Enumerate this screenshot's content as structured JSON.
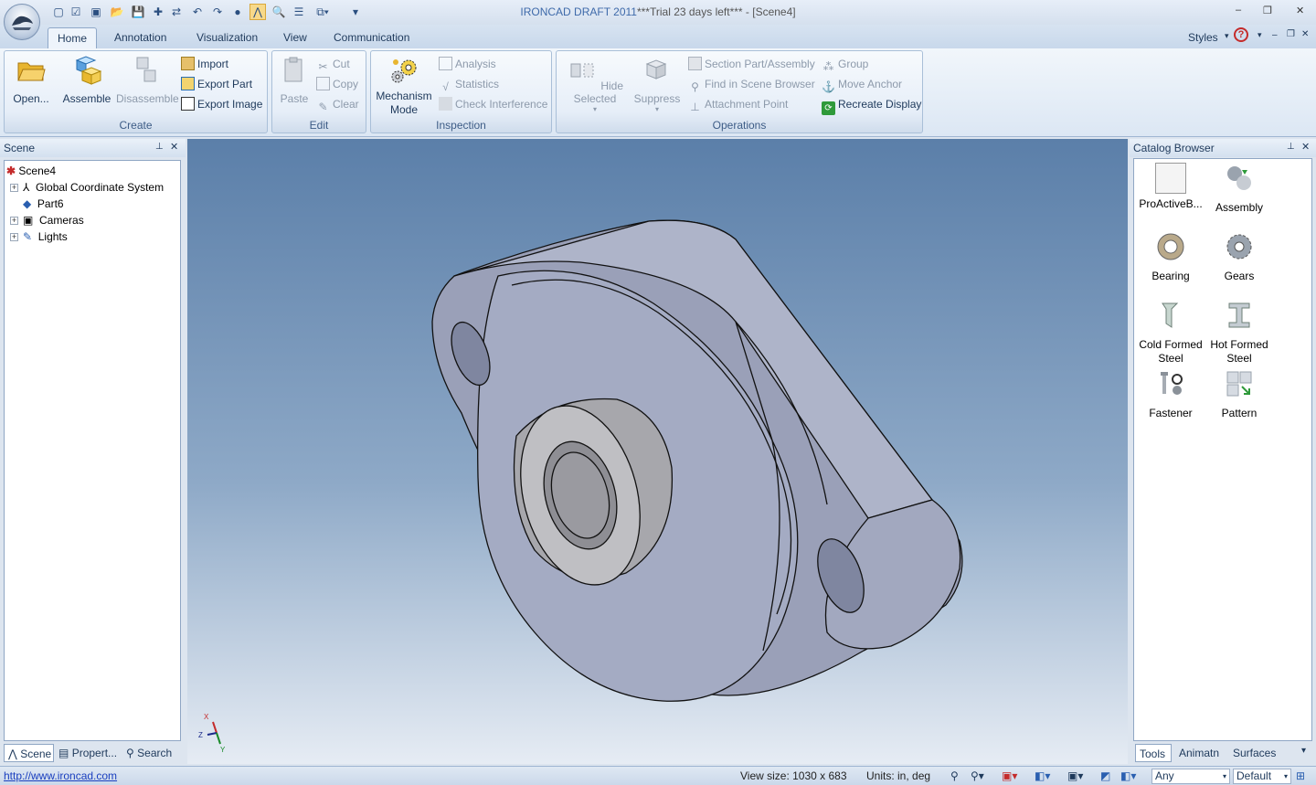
{
  "window": {
    "title_prefix": "IRONCAD DRAFT 2011",
    "title_suffix": "***Trial 23 days left*** - [Scene4]",
    "min_btn": "–",
    "max_btn": "❐",
    "close_btn": "✕"
  },
  "tabs": [
    "Home",
    "Annotation",
    "Visualization",
    "View",
    "Communication"
  ],
  "styles_label": "Styles",
  "ribbon": {
    "create": {
      "label": "Create",
      "open": "Open...",
      "assemble": "Assemble",
      "disassemble": "Disassemble",
      "import": "Import",
      "export_part": "Export Part",
      "export_image": "Export Image"
    },
    "edit": {
      "label": "Edit",
      "paste": "Paste",
      "cut": "Cut",
      "copy": "Copy",
      "clear": "Clear"
    },
    "inspection": {
      "label": "Inspection",
      "mechanism_1": "Mechanism",
      "mechanism_2": "Mode",
      "analysis": "Analysis",
      "statistics": "Statistics",
      "check_interference": "Check Interference"
    },
    "operations": {
      "label": "Operations",
      "hide_selected": "Hide Selected",
      "suppress": "Suppress",
      "section": "Section Part/Assembly",
      "find": "Find in Scene Browser",
      "attachment": "Attachment Point",
      "group": "Group",
      "move_anchor": "Move Anchor",
      "recreate": "Recreate Display"
    }
  },
  "scene_panel": {
    "title": "Scene",
    "items": [
      "Scene4",
      "Global Coordinate System",
      "Part6",
      "Cameras",
      "Lights"
    ],
    "bottom_tabs": [
      "Scene",
      "Propert...",
      "Search"
    ]
  },
  "catalog": {
    "title": "Catalog Browser",
    "items": [
      {
        "l1": "ProActiveB...",
        "l2": ""
      },
      {
        "l1": "Assembly",
        "l2": ""
      },
      {
        "l1": "Bearing",
        "l2": ""
      },
      {
        "l1": "Gears",
        "l2": ""
      },
      {
        "l1": "Cold Formed",
        "l2": "Steel"
      },
      {
        "l1": "Hot Formed",
        "l2": "Steel"
      },
      {
        "l1": "Fastener",
        "l2": ""
      },
      {
        "l1": "Pattern",
        "l2": ""
      }
    ],
    "bottom_tabs": [
      "Tools",
      "Animatn",
      "Surfaces"
    ]
  },
  "triad": {
    "x": "X",
    "y": "Y",
    "z": "Z"
  },
  "status": {
    "url": "http://www.ironcad.com",
    "view_size": "View size: 1030 x  683",
    "units": "Units: in, deg",
    "combo_any": "Any",
    "combo_default": "Default"
  },
  "colors": {
    "accent": "#3e6aaa",
    "part": "#a4abc3",
    "viewport_top": "#5b7fa9"
  }
}
